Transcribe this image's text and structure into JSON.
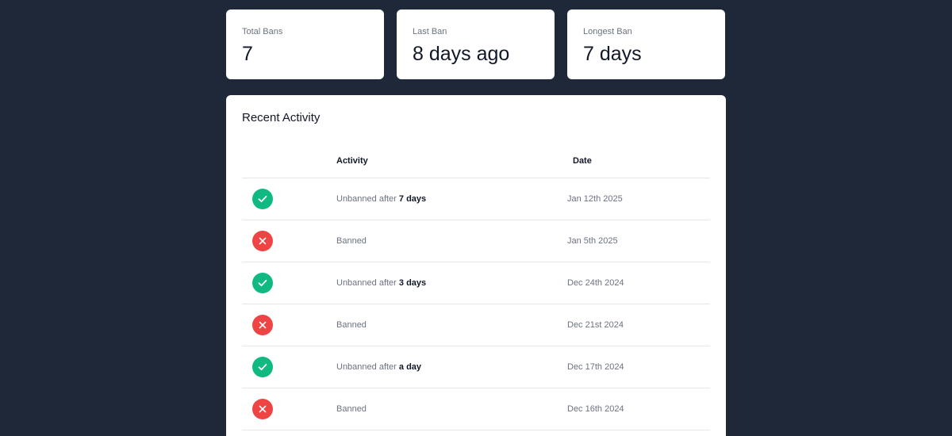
{
  "stats": [
    {
      "label": "Total Bans",
      "value": "7"
    },
    {
      "label": "Last Ban",
      "value": "8 days ago"
    },
    {
      "label": "Longest Ban",
      "value": "7 days"
    }
  ],
  "activity": {
    "title": "Recent Activity",
    "columns": {
      "activity": "Activity",
      "date": "Date"
    },
    "rows": [
      {
        "status": "unbanned",
        "icon": "check-icon",
        "text": "Unbanned after ",
        "duration": "7 days",
        "date": "Jan 12th 2025"
      },
      {
        "status": "banned",
        "icon": "x-icon",
        "text": "Banned",
        "duration": "",
        "date": "Jan 5th 2025"
      },
      {
        "status": "unbanned",
        "icon": "check-icon",
        "text": "Unbanned after ",
        "duration": "3 days",
        "date": "Dec 24th 2024"
      },
      {
        "status": "banned",
        "icon": "x-icon",
        "text": "Banned",
        "duration": "",
        "date": "Dec 21st 2024"
      },
      {
        "status": "unbanned",
        "icon": "check-icon",
        "text": "Unbanned after ",
        "duration": "a day",
        "date": "Dec 17th 2024"
      },
      {
        "status": "banned",
        "icon": "x-icon",
        "text": "Banned",
        "duration": "",
        "date": "Dec 16th 2024"
      }
    ]
  },
  "colors": {
    "background": "#1f2839",
    "success": "#10b981",
    "danger": "#ef4444"
  }
}
